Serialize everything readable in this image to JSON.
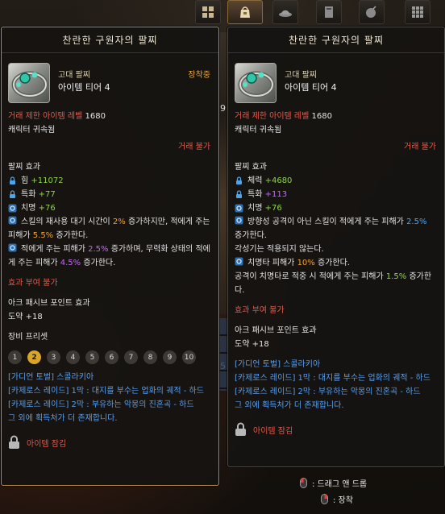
{
  "toolbar": {
    "buttons": [
      {
        "icon": "grid-icon",
        "active": false
      },
      {
        "icon": "bag-icon",
        "active": true
      },
      {
        "icon": "hat-icon",
        "active": false
      },
      {
        "icon": "book-icon",
        "active": false
      },
      {
        "icon": "bomb-icon",
        "active": false
      },
      {
        "icon": "grid-dense-icon",
        "active": false
      }
    ]
  },
  "background": {
    "numbers": [
      "9",
      "5"
    ]
  },
  "left": {
    "title": "찬란한 구원자의 팔찌",
    "grade": "고대 팔찌",
    "tier": "아이템 티어 4",
    "equipped": "장착중",
    "trade_limit_label": "거래 제한 아이템 레벨",
    "trade_limit_value": "1680",
    "bound": "캐릭터 귀속됨",
    "trade_status": "거래 불가",
    "effect_header": "팔찌 효과",
    "stats": [
      {
        "name": "힘",
        "value": "+11072",
        "icon": "lock-icon"
      },
      {
        "name": "특화",
        "value": "+77",
        "icon": "lock-icon"
      },
      {
        "name": "치명",
        "value": "+76",
        "icon": "gear-icon"
      }
    ],
    "effect1": {
      "a": "스킬의 재사용 대기 시간이 ",
      "b": "2%",
      "c": " 증가하지만, 적에게 주는 피해가 ",
      "d": "5.5%",
      "e": " 증가한다."
    },
    "effect2": {
      "a": "적에게 주는 피해가 ",
      "b": "2.5%",
      "c": " 증가하며, 무력화 상태의 적에게 주는 피해가 ",
      "d": "4.5%",
      "e": " 증가한다."
    },
    "grant_status": "효과 부여 불가",
    "ark_header": "아크 패시브 포인트 효과",
    "ark_value": "도약 +18",
    "preset_label": "장비 프리셋",
    "presets": [
      "1",
      "2",
      "3",
      "4",
      "5",
      "6",
      "7",
      "8",
      "9",
      "10"
    ],
    "preset_active": "2",
    "sources": [
      "[가디언 토벌] 스콜라키아",
      "[카제로스 레이드] 1막 : 대지를 부수는 업화의 궤적 - 하드",
      "[카제로스 레이드] 2막 : 부유하는 악몽의 진혼곡 - 하드"
    ],
    "source_note": "그 외에 획득처가 더 존재합니다.",
    "lock_label": "아이템 잠김"
  },
  "right": {
    "title": "찬란한 구원자의 팔찌",
    "grade": "고대 팔찌",
    "tier": "아이템 티어 4",
    "trade_limit_label": "거래 제한 아이템 레벨",
    "trade_limit_value": "1680",
    "bound": "캐릭터 귀속됨",
    "trade_status": "거래 불가",
    "effect_header": "팔찌 효과",
    "stats": [
      {
        "name": "체력",
        "value": "+4680",
        "icon": "lock-icon",
        "color": "green"
      },
      {
        "name": "특화",
        "value": "+113",
        "icon": "lock-icon",
        "color": "purple"
      },
      {
        "name": "치명",
        "value": "+76",
        "icon": "gear-icon",
        "color": "green"
      }
    ],
    "effect1": {
      "a": "방향성 공격이 아닌 스킬이 적에게 주는 피해가 ",
      "b": "2.5%",
      "c": " 증가한다."
    },
    "effect1_note": "각성기는 적용되지 않는다.",
    "effect2": {
      "a": "치명타 피해가 ",
      "b": "10%",
      "c": " 증가한다."
    },
    "effect2_note": {
      "a": "공격이 치명타로 적중 시 적에게 주는 피해가 ",
      "b": "1.5%",
      "c": " 증가한다."
    },
    "grant_status": "효과 부여 불가",
    "ark_header": "아크 패시브 포인트 효과",
    "ark_value": "도약 +18",
    "sources": [
      "[가디언 토벌] 스콜라키아",
      "[카제로스 레이드] 1막 : 대지를 부수는 업화의 궤적 - 하드",
      "[카제로스 레이드] 2막 : 부유하는 악몽의 진혼곡 - 하드"
    ],
    "source_note": "그 외에 획득처가 더 존재합니다.",
    "lock_label": "아이템 잠김"
  },
  "hints": {
    "drag": ": 드래그 앤 드롭",
    "equip": ": 장착"
  },
  "colors": {
    "accent_gold": "#d8a42a",
    "stat_green": "#8fd24e",
    "stat_purple": "#c06cf0",
    "warn_red": "#e05a4a",
    "link_blue": "#5a9eea"
  }
}
